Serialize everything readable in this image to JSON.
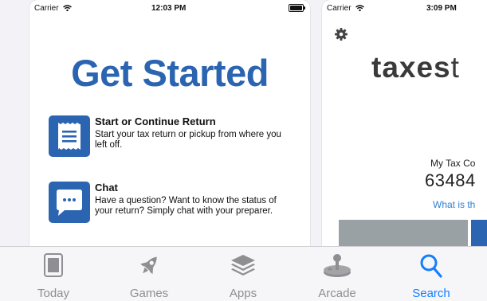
{
  "screenshot1": {
    "status": {
      "carrier": "Carrier",
      "time": "12:03 PM"
    },
    "title": "Get Started",
    "items": [
      {
        "title": "Start or Continue Return",
        "description": "Start your tax return or pickup from where you left off."
      },
      {
        "title": "Chat",
        "description": "Have a question?  Want to know the status of your return? Simply chat with your preparer."
      }
    ]
  },
  "screenshot2": {
    "status": {
      "carrier": "Carrier",
      "time": "3:09 PM"
    },
    "logo": "taxes",
    "logo_cut": "t",
    "code_label": "My Tax Co",
    "code_value": "63484",
    "link": "What is th"
  },
  "tabbar": {
    "tabs": [
      {
        "label": "Today",
        "icon": "today-icon"
      },
      {
        "label": "Games",
        "icon": "rocket-icon"
      },
      {
        "label": "Apps",
        "icon": "apps-stack-icon"
      },
      {
        "label": "Arcade",
        "icon": "joystick-icon"
      },
      {
        "label": "Search",
        "icon": "search-icon",
        "active": true
      }
    ]
  },
  "colors": {
    "brand": "#2b64b0",
    "active_tab": "#157efb",
    "inactive_tab": "#8e8e93"
  }
}
